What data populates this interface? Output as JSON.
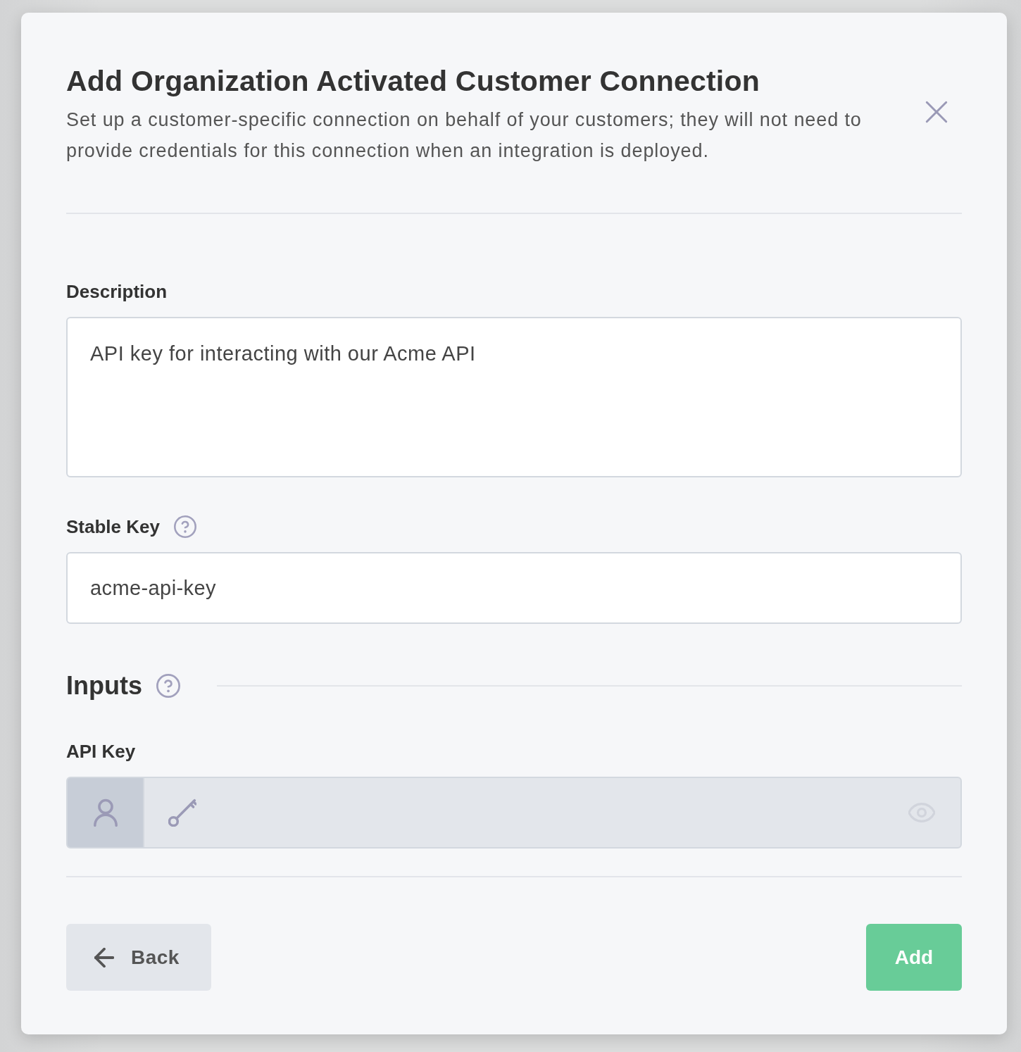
{
  "dialog": {
    "title": "Add Organization Activated Customer Connection",
    "subtitle": "Set up a customer-specific connection on behalf of your customers; they will not need to provide credentials for this connection when an integration is deployed."
  },
  "fields": [
    {
      "kind": "textarea",
      "label": "Description",
      "value": "API key for interacting with our Acme API",
      "help": false
    },
    {
      "kind": "text",
      "label": "Stable Key",
      "value": "acme-api-key",
      "help": true
    }
  ],
  "inputs_section": {
    "title": "Inputs",
    "help": true,
    "fields": [
      {
        "kind": "secret",
        "label": "API Key",
        "disabled": true
      }
    ]
  },
  "buttons": [
    {
      "kind": "back",
      "label": "Back"
    },
    {
      "kind": "primary",
      "label": "Add"
    }
  ]
}
